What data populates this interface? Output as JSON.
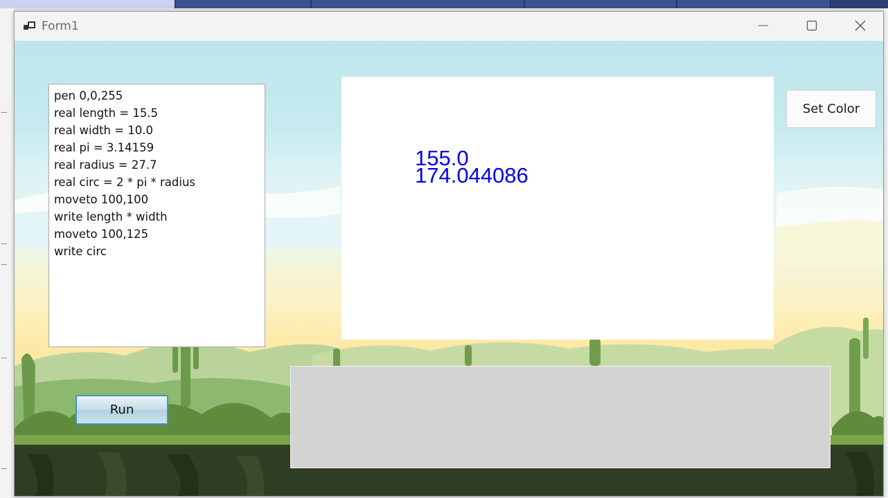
{
  "window": {
    "title": "Form1"
  },
  "editor": {
    "lines": [
      "pen 0,0,255",
      "real length = 15.5",
      "real width = 10.0",
      "real pi = 3.14159",
      "real radius = 27.7",
      "real circ = 2 * pi * radius",
      "moveto 100,100",
      "write length * width",
      "moveto 100,125",
      "write circ"
    ]
  },
  "canvas": {
    "outputs": [
      "155.0",
      "174.044086"
    ],
    "pen_color": "#0000ee"
  },
  "buttons": {
    "set_color": "Set Color",
    "run": "Run"
  },
  "icons": {
    "app": "app-icon",
    "minimize": "minimize-icon",
    "maximize": "maximize-icon",
    "close": "close-icon"
  }
}
